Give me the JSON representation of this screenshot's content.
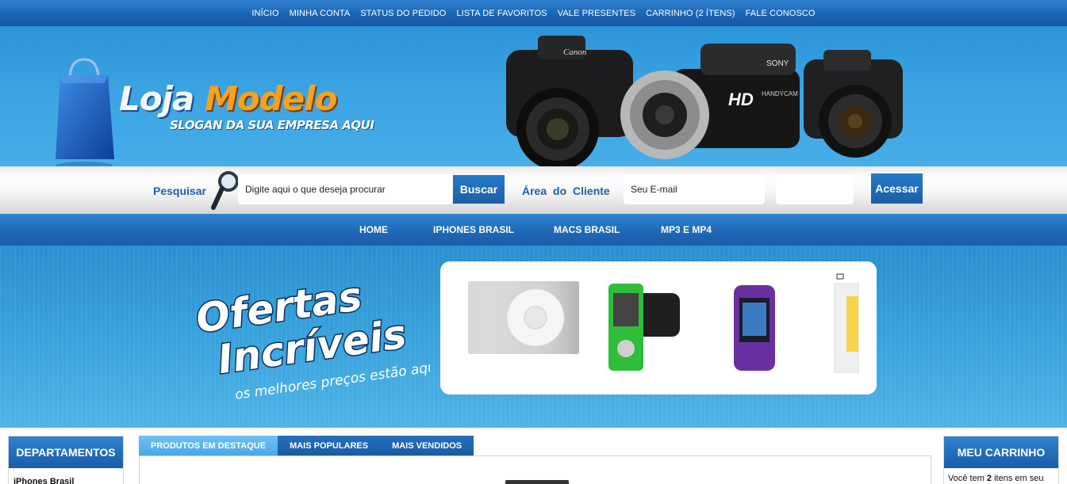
{
  "top_nav": {
    "items": [
      "INÍCIO",
      "MINHA CONTA",
      "STATUS DO PEDIDO",
      "LISTA DE FAVORITOS",
      "VALE PRESENTES",
      "CARRINHO (2 ÍTENS)",
      "FALE CONOSCO"
    ]
  },
  "logo": {
    "word1": "Loja",
    "word2": "Modelo",
    "slogan": "SLOGAN DA SUA EMPRESA AQUI"
  },
  "header_image": {
    "brands": [
      "Canon",
      "SONY",
      "HD",
      "HANDYCAM"
    ]
  },
  "search": {
    "label": "Pesquisar",
    "input_value": "Digite aqui o que deseja procurar",
    "button": "Buscar"
  },
  "client_area": {
    "label": "Área do Cliente",
    "email_value": "Seu E-mail",
    "password_value": "",
    "button": "Acessar"
  },
  "main_nav": {
    "items": [
      "HOME",
      "IPHONES BRASIL",
      "MACS BRASIL",
      "MP3 E MP4"
    ]
  },
  "banner": {
    "title_line1": "Ofertas",
    "title_line2": "Incríveis",
    "subtitle": "os melhores preços estão aqui!",
    "products": [
      "ipod-shuffle",
      "armband-green",
      "iphone-case-purple",
      "product-box"
    ]
  },
  "left_sidebar": {
    "title": "DEPARTAMENTOS",
    "first_item": "iPhones Brasil"
  },
  "tabs": [
    "PRODUTOS EM DESTAQUE",
    "MAIS POPULARES",
    "MAIS VENDIDOS"
  ],
  "cart": {
    "title": "MEU CARRINHO",
    "text_prefix": "Você tem ",
    "count": "2",
    "text_suffix": " itens em seu"
  },
  "colors": {
    "primary_blue": "#1a63b4",
    "sky_blue": "#3aa3e2",
    "logo_orange": "#f7a21b",
    "label_blue": "#1d5fa6"
  }
}
